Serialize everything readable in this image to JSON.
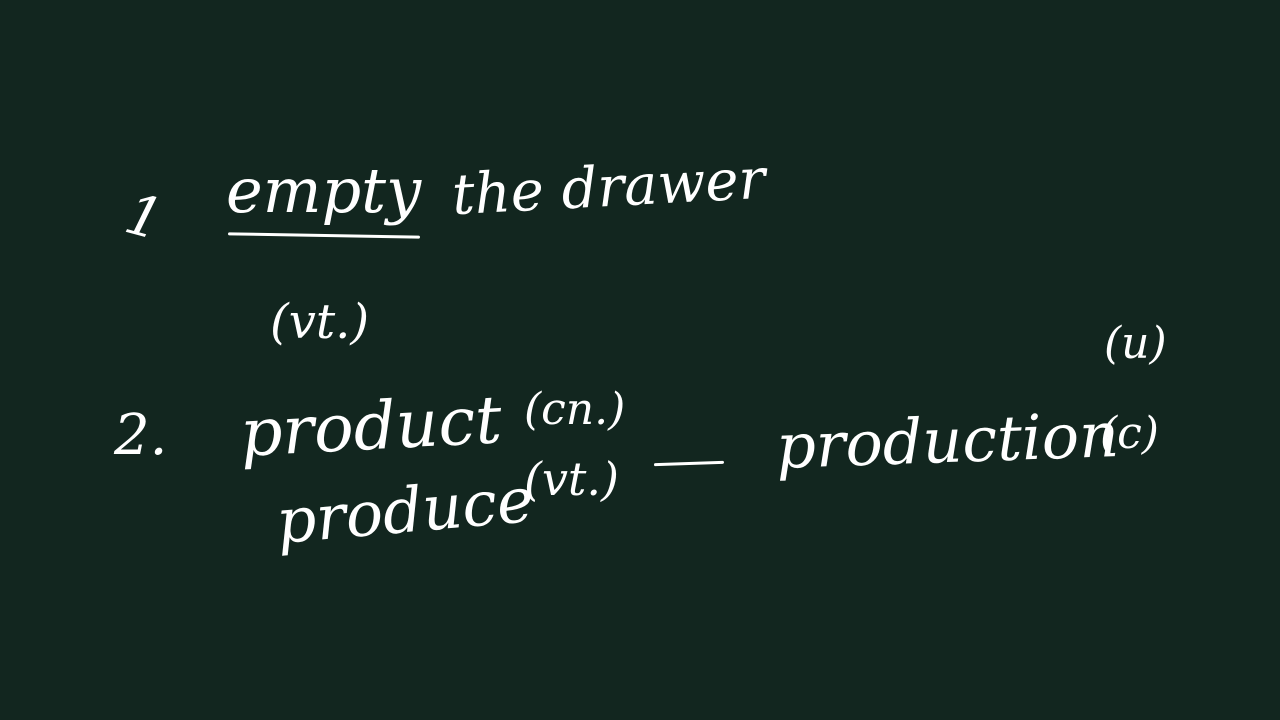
{
  "colors": {
    "board": "#12261f",
    "chalk": "#ffffff"
  },
  "item1": {
    "number": "1",
    "phrase_word": "empty",
    "phrase_rest": "the drawer",
    "pos": "(vt.)"
  },
  "item2": {
    "number": "2.",
    "word1": "product",
    "word1_pos": "(cn.)",
    "word2": "produce",
    "word2_pos": "(vt.)",
    "word3": "production",
    "word3_pos_top": "(u)",
    "word3_pos": "(c)"
  }
}
